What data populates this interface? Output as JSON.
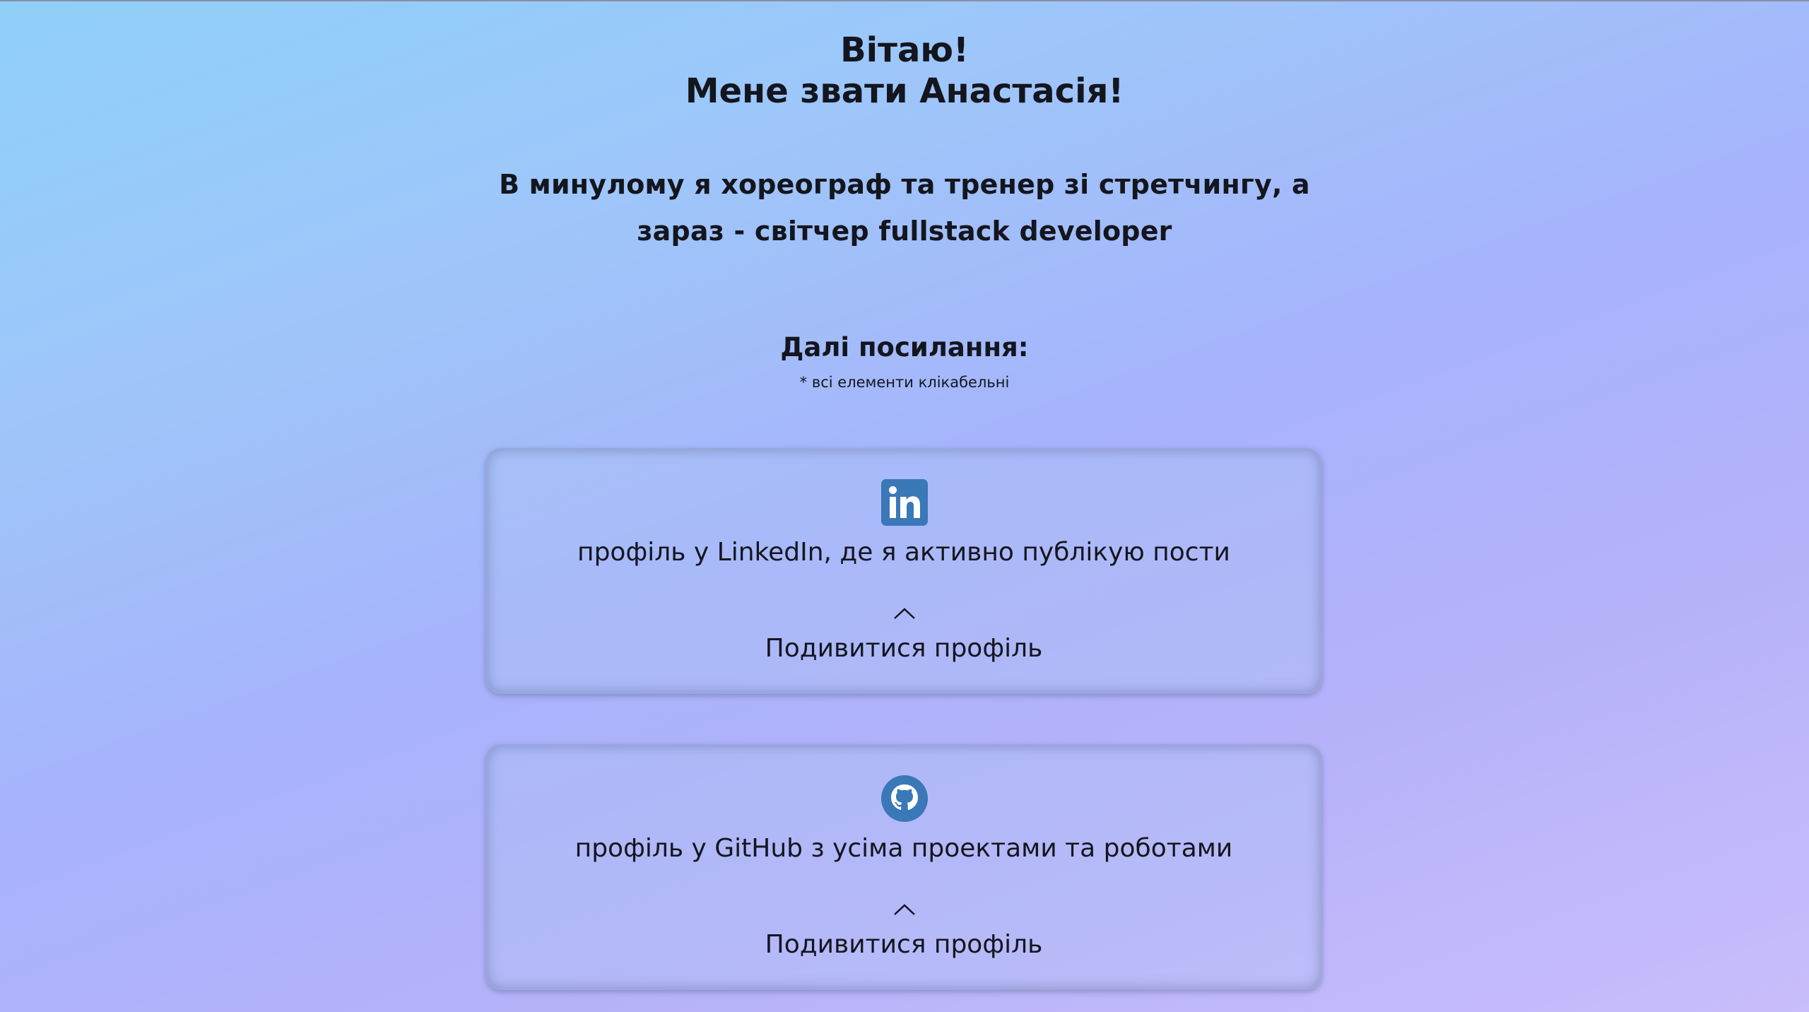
{
  "header": {
    "greeting_line1": "Вітаю!",
    "greeting_line2": "Мене звати Анастасія!"
  },
  "intro": {
    "text": "В минулому я хореограф та тренер зі стретчингу, а зараз - світчер fullstack developer"
  },
  "links": {
    "heading": "Далі посилання:",
    "note": "* всі елементи клікабельні"
  },
  "cards": [
    {
      "icon": "linkedin-icon",
      "text": "профіль у LinkedIn, де я активно публікую пости",
      "action": "Подивитися профіль"
    },
    {
      "icon": "github-icon",
      "text": "профіль у GitHub з усіма проектами та роботами",
      "action": "Подивитися профіль"
    }
  ],
  "colors": {
    "icon_blue": "#3a78b8",
    "text": "#14161e"
  }
}
